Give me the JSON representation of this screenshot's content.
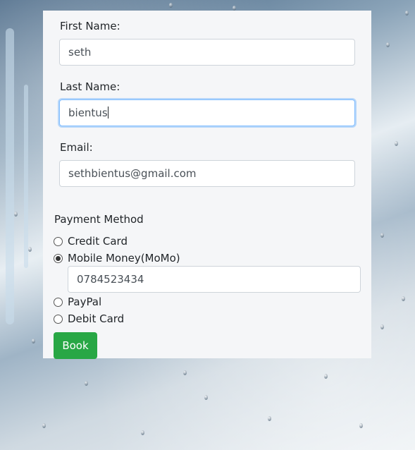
{
  "form": {
    "first_name_label": "First Name:",
    "first_name_value": "seth",
    "last_name_label": "Last Name:",
    "last_name_value": "bientus",
    "email_label": "Email:",
    "email_value": "sethbientus@gmail.com",
    "payment_method_label": "Payment Method",
    "payment_options": [
      {
        "label": "Credit Card",
        "checked": false
      },
      {
        "label": "Mobile Money(MoMo)",
        "checked": true
      },
      {
        "label": "PayPal",
        "checked": false
      },
      {
        "label": "Debit Card",
        "checked": false
      }
    ],
    "momo_number_value": "0784523434",
    "book_label": "Book"
  },
  "colors": {
    "book_button": "#28a745",
    "card_background": "#f5f6f8",
    "focus_ring": "#80bdff"
  }
}
